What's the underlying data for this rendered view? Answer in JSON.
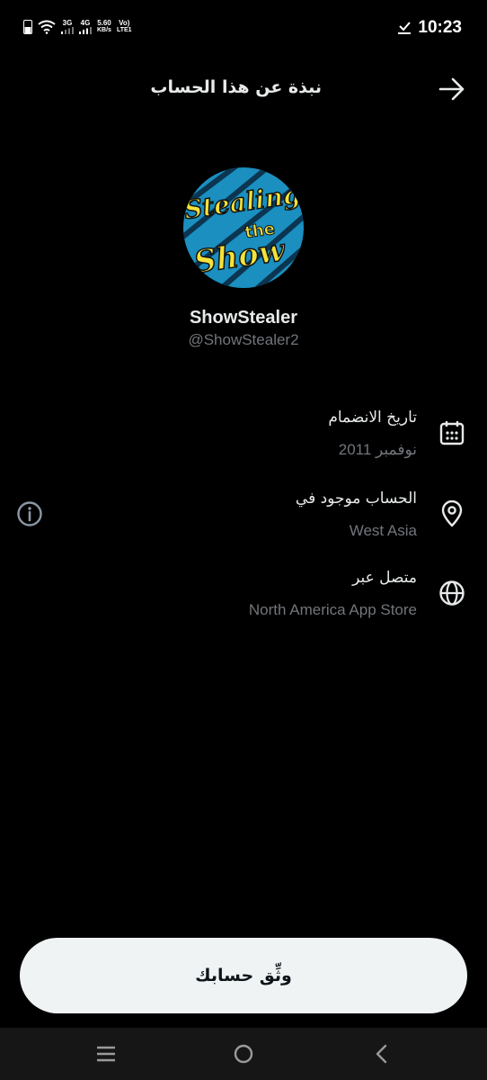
{
  "status_bar": {
    "net_3g": "3G",
    "net_4g": "4G",
    "speed": "5.60",
    "speed_unit": "KB/s",
    "volte_top": "Vo)",
    "volte_bottom": "LTE1",
    "time": "10:23"
  },
  "header": {
    "title": "نبذة عن هذا الحساب"
  },
  "profile": {
    "display_name": "ShowStealer",
    "handle": "@ShowStealer2",
    "avatar_text_top": "Stealing",
    "avatar_text_mid": "the",
    "avatar_text_bottom": "Show"
  },
  "details": [
    {
      "label": "تاريخ الانضمام",
      "value": "نوفمبر 2011",
      "icon": "calendar-icon"
    },
    {
      "label": "الحساب موجود في",
      "value": "West Asia",
      "icon": "location-pin-icon"
    },
    {
      "label": "متصل عبر",
      "value": "North America App Store",
      "icon": "globe-icon"
    }
  ],
  "verify_button": {
    "label": "وثِّق حسابك"
  },
  "colors": {
    "background": "#000000",
    "primary_text": "#e7e9ea",
    "secondary_text": "#71767b",
    "button_bg": "#eff3f4"
  }
}
